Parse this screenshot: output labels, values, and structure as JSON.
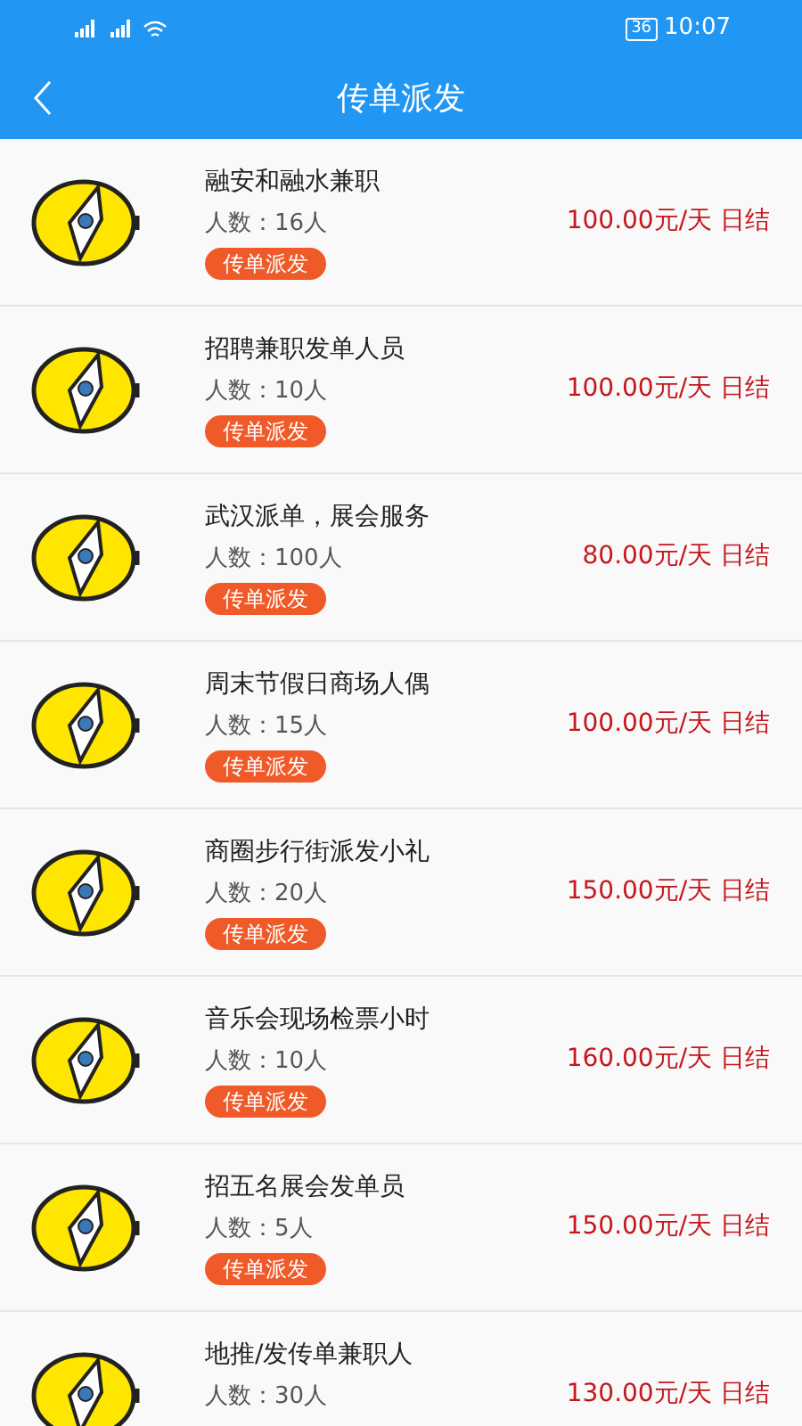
{
  "status_bar": {
    "battery": "36",
    "time": "10:07"
  },
  "header": {
    "title": "传单派发"
  },
  "jobs": [
    {
      "title": "融安和融水兼职",
      "count": "人数：16人",
      "tag": "传单派发",
      "pay": "100.00元/天 日结"
    },
    {
      "title": "招聘兼职发单人员",
      "count": "人数：10人",
      "tag": "传单派发",
      "pay": "100.00元/天 日结"
    },
    {
      "title": "武汉派单，展会服务",
      "count": "人数：100人",
      "tag": "传单派发",
      "pay": "80.00元/天 日结"
    },
    {
      "title": "周末节假日商场人偶",
      "count": "人数：15人",
      "tag": "传单派发",
      "pay": "100.00元/天 日结"
    },
    {
      "title": "商圈步行街派发小礼",
      "count": "人数：20人",
      "tag": "传单派发",
      "pay": "150.00元/天 日结"
    },
    {
      "title": "音乐会现场检票小时",
      "count": "人数：10人",
      "tag": "传单派发",
      "pay": "160.00元/天 日结"
    },
    {
      "title": "招五名展会发单员",
      "count": "人数：5人",
      "tag": "传单派发",
      "pay": "150.00元/天 日结"
    },
    {
      "title": "地推/发传单兼职人",
      "count": "人数：30人",
      "pay": "130.00元/天 日结"
    }
  ]
}
